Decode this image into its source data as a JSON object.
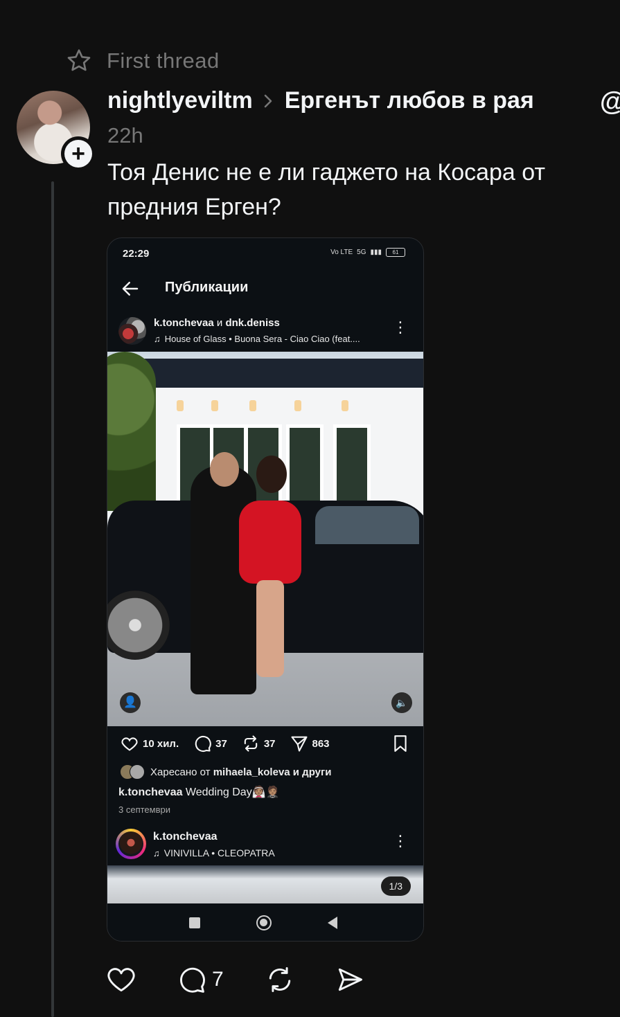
{
  "header": {
    "first_thread_label": "First thread",
    "username": "nightlyeviltm",
    "community": "Ергенът любов в рая",
    "time": "22h",
    "at_icon": "@"
  },
  "post": {
    "text": "Тоя Денис не е ли гаджето на Косара от предния Ерген?"
  },
  "embedded": {
    "status_time": "22:29",
    "status_icons": {
      "volte": "Vo LTE",
      "network": "5G",
      "battery": "61"
    },
    "page_title": "Публикации",
    "post1": {
      "author_a": "k.tonchevaa",
      "author_joiner": " и ",
      "author_b": "dnk.deniss",
      "music": "House of Glass • Buona Sera - Ciao Ciao (feat....",
      "likes": "10 хил.",
      "comments": "37",
      "reposts": "37",
      "shares": "863",
      "liked_by_prefix": "Харесано от ",
      "liked_by_user": "mihaela_koleva",
      "liked_by_suffix": " и други",
      "caption_user": "k.tonchevaa",
      "caption_text": " Wedding Day👰🏽🤵🏽",
      "date": "3 септември"
    },
    "post2": {
      "author": "k.tonchevaa",
      "music": "VINIVILLA • CLEOPATRA",
      "pager": "1/3"
    }
  },
  "actions": {
    "reply_count": "7"
  },
  "icons": {
    "star": "star-icon",
    "plus": "plus-icon",
    "chevron": "chevron-right-icon",
    "back": "arrow-left-icon",
    "heart": "heart-icon",
    "comment": "comment-icon",
    "repost": "repost-icon",
    "send": "send-icon",
    "bookmark": "bookmark-icon"
  },
  "colors": {
    "background": "#101010",
    "text": "#f3f5f7",
    "muted": "#777777",
    "phone_bg": "#0c1014",
    "dress_red": "#d41423"
  }
}
